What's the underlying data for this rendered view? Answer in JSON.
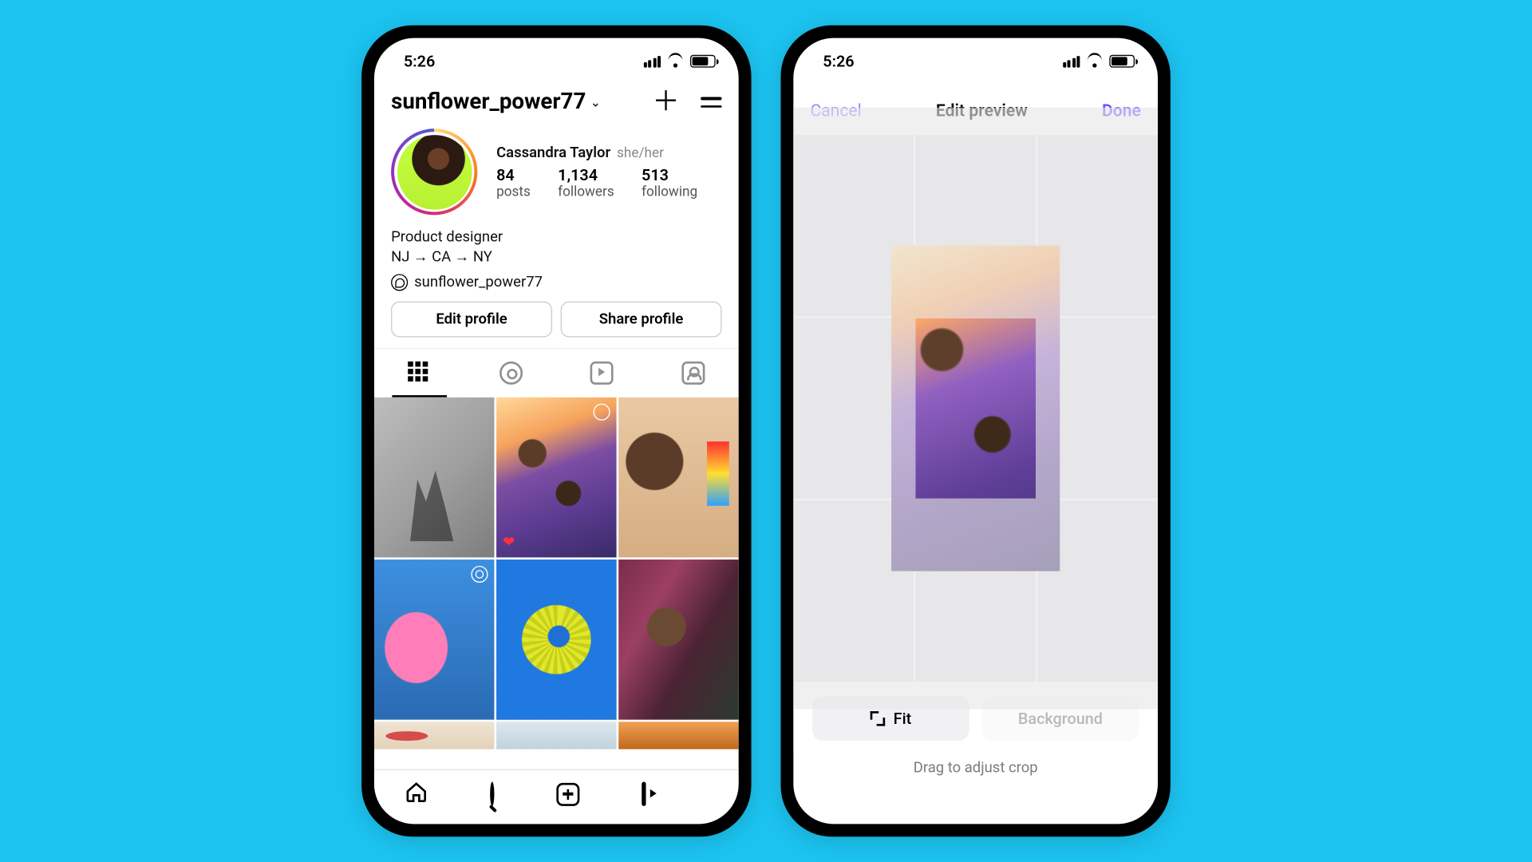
{
  "status": {
    "time": "5:26"
  },
  "profile": {
    "username": "sunflower_power77",
    "display_name": "Cassandra Taylor",
    "pronouns": "she/her",
    "stats": {
      "posts": {
        "value": "84",
        "label": "posts"
      },
      "followers": {
        "value": "1,134",
        "label": "followers"
      },
      "following": {
        "value": "513",
        "label": "following"
      }
    },
    "bio_line1": "Product designer",
    "bio_line2": "NJ → CA → NY",
    "threads_handle": "sunflower_power77",
    "actions": {
      "edit_profile": "Edit profile",
      "share_profile": "Share profile"
    },
    "tabs": [
      "grid",
      "reels",
      "video",
      "tagged"
    ]
  },
  "editor": {
    "cancel": "Cancel",
    "title": "Edit preview",
    "done": "Done",
    "fit": "Fit",
    "background": "Background",
    "hint": "Drag to adjust crop"
  }
}
